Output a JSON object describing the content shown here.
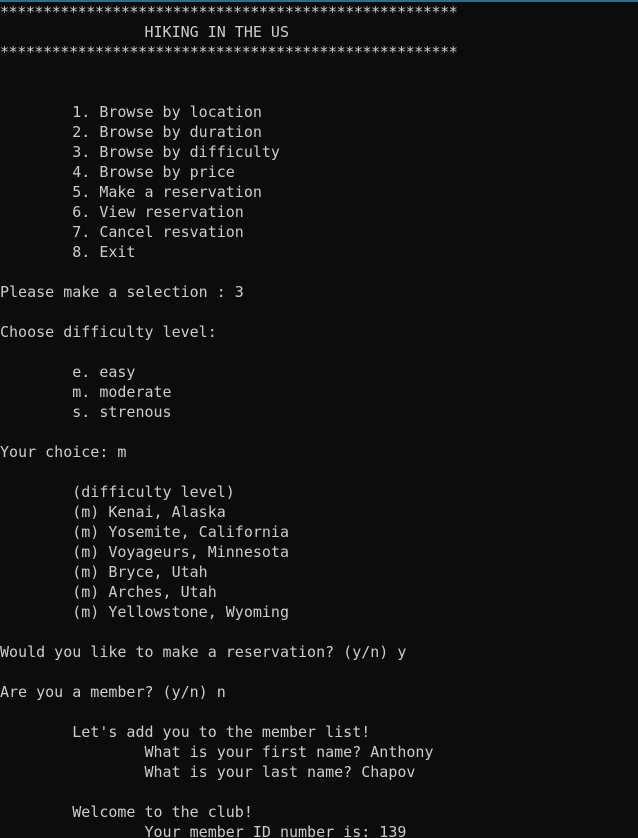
{
  "colors": {
    "background": "#0c0c0c",
    "text": "#cccccc",
    "window_border": "#2f6f86"
  },
  "console": {
    "lines": [
      "*****************************************************",
      "                HIKING IN THE US",
      "*****************************************************",
      "",
      "",
      "        1. Browse by location",
      "        2. Browse by duration",
      "        3. Browse by difficulty",
      "        4. Browse by price",
      "        5. Make a reservation",
      "        6. View reservation",
      "        7. Cancel resvation",
      "        8. Exit",
      "",
      "Please make a selection : 3",
      "",
      "Choose difficulty level:",
      "",
      "        e. easy",
      "        m. moderate",
      "        s. strenous",
      "",
      "Your choice: m",
      "",
      "        (difficulty level)",
      "        (m) Kenai, Alaska",
      "        (m) Yosemite, California",
      "        (m) Voyageurs, Minnesota",
      "        (m) Bryce, Utah",
      "        (m) Arches, Utah",
      "        (m) Yellowstone, Wyoming",
      "",
      "Would you like to make a reservation? (y/n) y",
      "",
      "Are you a member? (y/n) n",
      "",
      "        Let's add you to the member list!",
      "                What is your first name? Anthony",
      "                What is your last name? Chapov",
      "",
      "        Welcome to the club!",
      "                Your member ID number is: 139"
    ]
  }
}
